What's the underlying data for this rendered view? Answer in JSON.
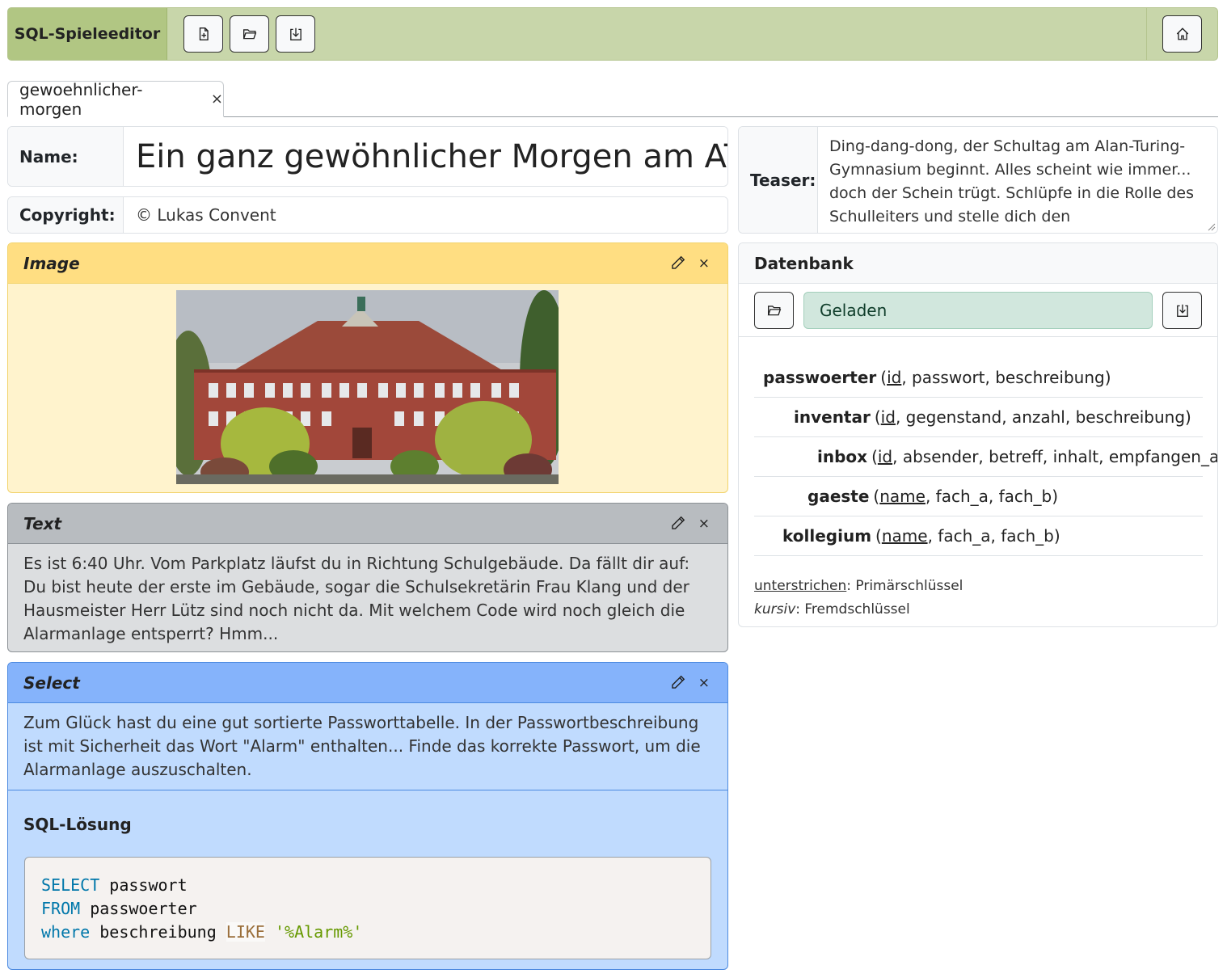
{
  "navbar": {
    "brand": "SQL-Spieleeditor",
    "buttons": [
      {
        "icon": "file-plus-icon"
      },
      {
        "icon": "folder-open-icon"
      },
      {
        "icon": "download-icon"
      }
    ],
    "home_icon": "home-icon"
  },
  "tabs": [
    {
      "label": "gewoehnlicher-morgen",
      "close": "×"
    }
  ],
  "meta": {
    "name_label": "Name:",
    "name_value": "Ein ganz gewöhnlicher Morgen am ATG?",
    "copyright_label": "Copyright:",
    "copyright_value": "© Lukas Convent",
    "teaser_label": "Teaser:",
    "teaser_value": "Ding-dang-dong, der Schultag am Alan-Turing-Gymnasium beginnt. Alles scheint wie immer... doch der Schein trügt. Schlüpfe in die Rolle des Schulleiters und stelle dich den Herausforderungen"
  },
  "cards": {
    "image": {
      "title": "Image",
      "close": "×"
    },
    "text": {
      "title": "Text",
      "close": "×",
      "body": "Es ist 6:40 Uhr. Vom Parkplatz läufst du in Richtung Schulgebäude. Da fällt dir auf: Du bist heute der erste im Gebäude, sogar die Schulsekretärin Frau Klang und der Hausmeister Herr Lütz sind noch nicht da. Mit welchem Code wird noch gleich die Alarmanlage entsperrt? Hmm..."
    },
    "select": {
      "title": "Select",
      "close": "×",
      "body": "Zum Glück hast du eine gut sortierte Passworttabelle. In der Passwortbeschreibung ist mit Sicherheit das Wort \"Alarm\" enthalten... Finde das korrekte Passwort, um die Alarmanlage auszuschalten.",
      "solution_title": "SQL-Lösung",
      "code": {
        "l1_kw": "SELECT",
        "l1_rest": " passwort",
        "l2_kw": "FROM",
        "l2_rest": " passwoerter",
        "l3_kw": "where",
        "l3_mid": " beschreibung ",
        "l3_op": "LIKE",
        "l3_str": "'%Alarm%'"
      }
    }
  },
  "database": {
    "title": "Datenbank",
    "status": "Geladen",
    "tables": [
      {
        "name": "passwoerter",
        "pk": "id",
        "rest": ", passwort, beschreibung)"
      },
      {
        "name": "inventar",
        "pk": "id",
        "rest": ", gegenstand, anzahl, beschreibung)"
      },
      {
        "name": "inbox",
        "pk": "id",
        "rest": ", absender, betreff, inhalt, empfangen_am)"
      },
      {
        "name": "gaeste",
        "pk": "name",
        "rest": ", fach_a, fach_b)"
      },
      {
        "name": "kollegium",
        "pk": "name",
        "rest": ", fach_a, fach_b)"
      }
    ],
    "legend": {
      "underline_term": "unterstrichen",
      "underline_desc": ": Primärschlüssel",
      "italic_term": "kursiv",
      "italic_desc": ": Fremdschlüssel"
    }
  }
}
